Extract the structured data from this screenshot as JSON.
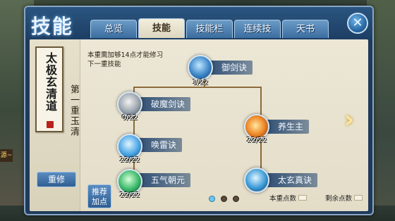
{
  "header": {
    "title": "技能",
    "close_label": "✕"
  },
  "tabs": [
    {
      "label": "总览"
    },
    {
      "label": "技能"
    },
    {
      "label": "技能栏"
    },
    {
      "label": "连续技"
    },
    {
      "label": "天书"
    }
  ],
  "side": {
    "scroll_text": "太极玄清道",
    "stage_label": "第一重玉清",
    "reset_label": "重修"
  },
  "hint": "本重需加够14点才能修习下一重技能",
  "recommend_label": "推荐加点",
  "skills": [
    {
      "name": "御剑诀",
      "count": "1/22",
      "icon": "sword-icon"
    },
    {
      "name": "破魔剑诀",
      "count": "0/22",
      "icon": "blade-icon"
    },
    {
      "name": "养生主",
      "count": "22/22",
      "icon": "flame-icon"
    },
    {
      "name": "唤雷诀",
      "count": "22/22",
      "icon": "lightning-icon"
    },
    {
      "name": "五气朝元",
      "count": "22/22",
      "icon": "figure-icon"
    },
    {
      "name": "太玄真诀",
      "count": "",
      "icon": "swirl-icon"
    }
  ],
  "points": {
    "current_label": "本重点数",
    "remaining_label": "剩余点数"
  },
  "left_badge": "源~",
  "colors": {
    "frame": "#1f3a5a",
    "panel": "#ece7d6",
    "tab": "#3b6da0",
    "active_tab": "#f2eedc",
    "skill_label": "#22446e"
  }
}
